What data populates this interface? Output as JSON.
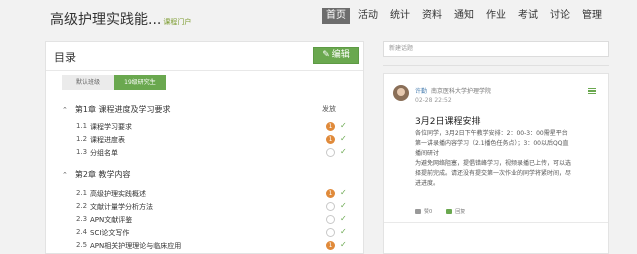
{
  "header": {
    "title": "高级护理实践能...",
    "subtitle": "课程门户",
    "nav": [
      {
        "label": "首页",
        "active": true
      },
      {
        "label": "活动",
        "active": false
      },
      {
        "label": "统计",
        "active": false
      },
      {
        "label": "资料",
        "active": false
      },
      {
        "label": "通知",
        "active": false
      },
      {
        "label": "作业",
        "active": false
      },
      {
        "label": "考试",
        "active": false
      },
      {
        "label": "讨论",
        "active": false
      },
      {
        "label": "管理",
        "active": false
      }
    ]
  },
  "catalog": {
    "title": "目录",
    "edit_label": "编辑",
    "tabs": [
      "默认班级",
      "19级研究生"
    ],
    "publish_header": "发放",
    "chapters": [
      {
        "title": "第1章 课程进度及学习要求",
        "sections": [
          {
            "num": "1.1",
            "title": "课程学习要求",
            "status": "1"
          },
          {
            "num": "1.2",
            "title": "课程进度表",
            "status": "1"
          },
          {
            "num": "1.3",
            "title": "分组名单",
            "status": ""
          }
        ]
      },
      {
        "title": "第2章 教学内容",
        "sections": [
          {
            "num": "2.1",
            "title": "高级护理实践概述",
            "status": "1"
          },
          {
            "num": "2.2",
            "title": "文献计量学分析方法",
            "status": ""
          },
          {
            "num": "2.3",
            "title": "APN文献评鉴",
            "status": ""
          },
          {
            "num": "2.4",
            "title": "SCI论文写作",
            "status": ""
          },
          {
            "num": "2.5",
            "title": "APN相关护理理论与临床应用",
            "status": "1"
          }
        ]
      }
    ]
  },
  "search": {
    "placeholder": "新建话题"
  },
  "post": {
    "author": "许勤",
    "school": "南京医科大学护理学院",
    "time": "02-28 22:52",
    "title": "3月2日课程安排",
    "body": [
      "各位同学，3月2日下午教学安排：2：00-3：00需星平台",
      "第一讲录播内容学习（2.1播色任务点）；3：00以后QQ直",
      "播间研讨",
      "为避免网络阻塞，提倡错峰学习，视频录播已上传，可以选",
      "择提前完成。请还没有提交第一次作业的同学将紧时间，尽",
      "进进度。"
    ],
    "like_label": "赞0",
    "reply_label": "回复"
  },
  "colors": {
    "accent": "#6aa84f",
    "warning": "#e08a3a",
    "link": "#4a7fb0"
  }
}
